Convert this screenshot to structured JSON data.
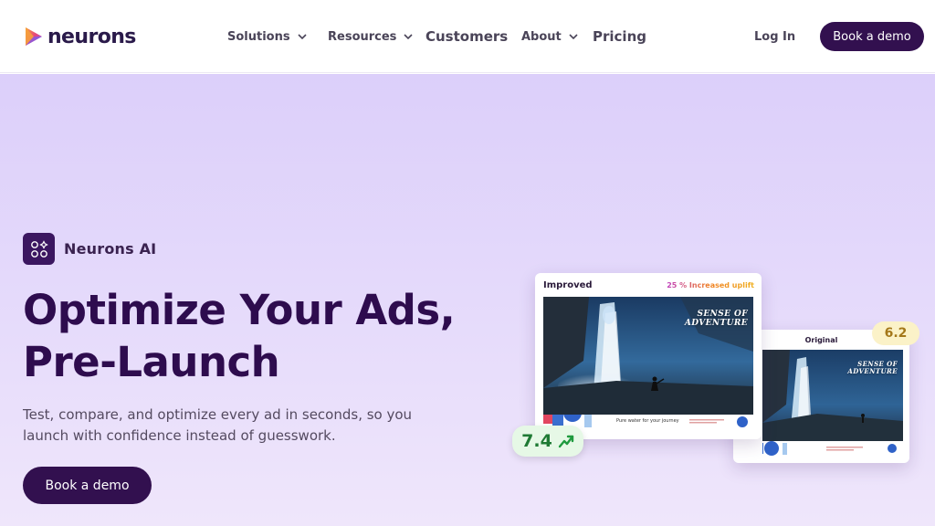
{
  "nav": {
    "logo_text": "neurons",
    "solutions": "Solutions",
    "resources": "Resources",
    "customers": "Customers",
    "about": "About",
    "pricing": "Pricing",
    "login": "Log In",
    "cta": "Book a demo"
  },
  "hero": {
    "badge": "Neurons AI",
    "headline_line1": "Optimize Your Ads,",
    "headline_line2": "Pre-Launch",
    "subtext": "Test, compare, and optimize every ad in seconds, so you launch with confidence instead of guesswork.",
    "cta": "Book a demo"
  },
  "cards": {
    "improved": {
      "title": "Improved",
      "uplift": "25 % Increased uplift",
      "ad_text_line1": "SENSE OF",
      "ad_text_line2": "ADVENTURE",
      "tagline": "Pure water for your journey",
      "score": "7.4"
    },
    "original": {
      "title": "Original",
      "ad_text_line1": "SENSE OF",
      "ad_text_line2": "ADVENTURE",
      "score": "6.2"
    }
  },
  "colors": {
    "brand_dark": "#32104f",
    "hero_gradient_top": "#dccffa",
    "hero_gradient_bottom": "#efe6fb",
    "score_good": "#1f7a34",
    "score_neutral": "#a4781a"
  },
  "icons": {
    "logo": "neurons-logo-icon",
    "chevron": "chevron-down-icon",
    "badge": "ai-shapes-icon",
    "trend": "trend-up-icon"
  }
}
